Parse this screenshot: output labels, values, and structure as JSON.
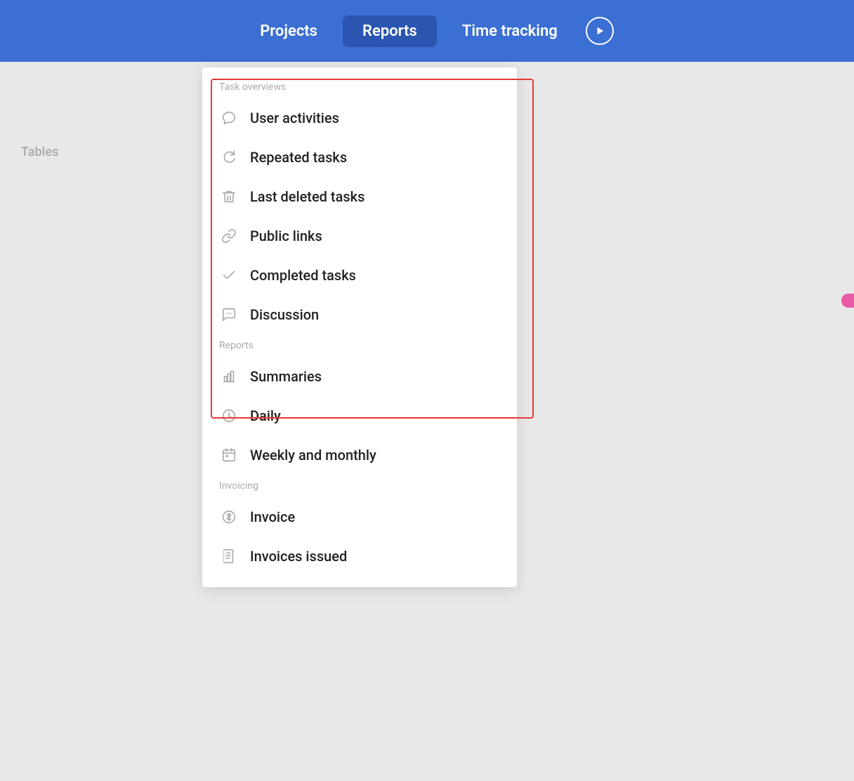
{
  "header": {
    "nav_items": [
      {
        "id": "projects",
        "label": "Projects",
        "active": false
      },
      {
        "id": "reports",
        "label": "Reports",
        "active": true
      },
      {
        "id": "time_tracking",
        "label": "Time tracking",
        "active": false
      }
    ],
    "play_button_label": "Play"
  },
  "sidebar": {
    "label": "Tables"
  },
  "dropdown": {
    "sections": [
      {
        "id": "task_overviews",
        "label": "Task overviews",
        "items": [
          {
            "id": "user_activities",
            "label": "User activities",
            "icon": "speech-bubble"
          },
          {
            "id": "repeated_tasks",
            "label": "Repeated tasks",
            "icon": "refresh"
          },
          {
            "id": "last_deleted_tasks",
            "label": "Last deleted tasks",
            "icon": "trash"
          },
          {
            "id": "public_links",
            "label": "Public links",
            "icon": "link"
          },
          {
            "id": "completed_tasks",
            "label": "Completed tasks",
            "icon": "checkmark"
          },
          {
            "id": "discussion",
            "label": "Discussion",
            "icon": "discussion"
          }
        ]
      },
      {
        "id": "reports",
        "label": "Reports",
        "items": [
          {
            "id": "summaries",
            "label": "Summaries",
            "icon": "bar-chart"
          },
          {
            "id": "daily",
            "label": "Daily",
            "icon": "clock"
          },
          {
            "id": "weekly_monthly",
            "label": "Weekly and monthly",
            "icon": "calendar"
          }
        ]
      },
      {
        "id": "invoicing",
        "label": "Invoicing",
        "items": [
          {
            "id": "invoice",
            "label": "Invoice",
            "icon": "dollar-circle"
          },
          {
            "id": "invoices_issued",
            "label": "Invoices issued",
            "icon": "book"
          }
        ]
      }
    ]
  }
}
